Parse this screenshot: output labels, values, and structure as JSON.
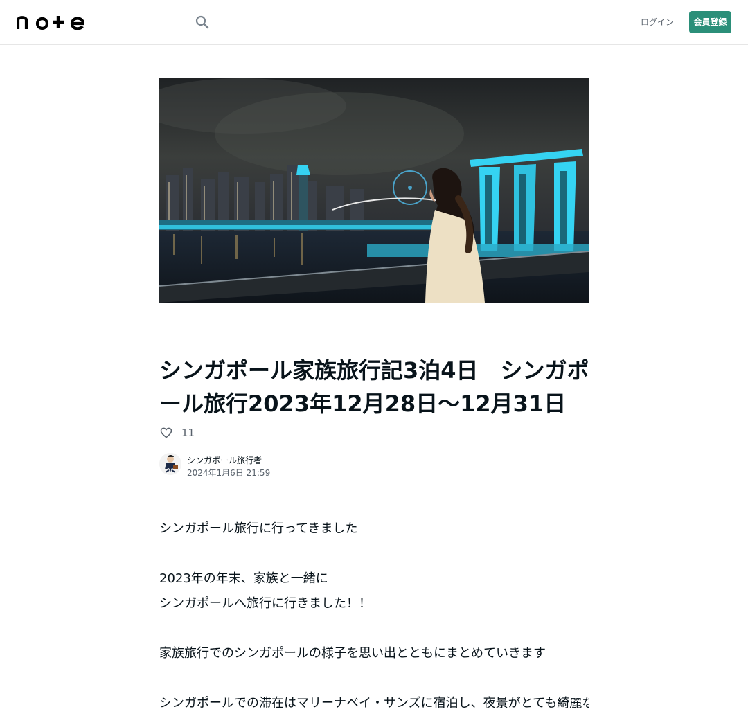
{
  "header": {
    "logo_text": "note",
    "login_label": "ログイン",
    "signup_label": "会員登録"
  },
  "article": {
    "title": "シンガポール家族旅行記3泊4日　シンガポール旅行2023年12月28日〜12月31日",
    "likes": "11",
    "author_name": "シンガポール旅行者",
    "date": "2024年1月6日 21:59",
    "paragraphs": [
      [
        "シンガポール旅行に行ってきました"
      ],
      [
        "2023年の年末、家族と一緒に",
        "シンガポールへ旅行に行きました！！"
      ],
      [
        "家族旅行でのシンガポールの様子を思い出とともにまとめていきます"
      ],
      [
        "シンガポールでの滞在はマリーナベイ・サンズに宿泊し、夜景がとても綺麗な場所で年末年始を過ごすことができて最高の旅行でした"
      ]
    ]
  },
  "colors": {
    "accent": "#2b8f79",
    "text": "#08131a",
    "muted": "#58616b",
    "city_light": "#35d3f2"
  }
}
